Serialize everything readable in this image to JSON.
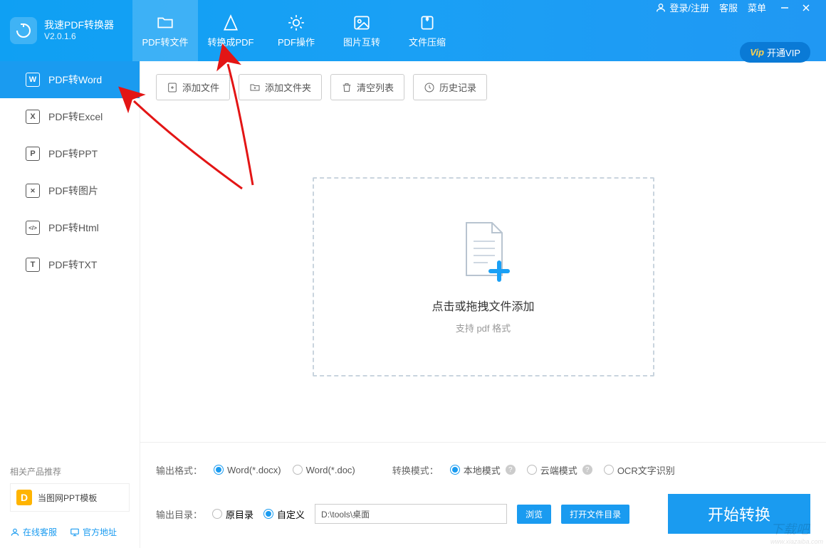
{
  "app": {
    "title": "我速PDF转换器",
    "version": "V2.0.1.6"
  },
  "header": {
    "tabs": [
      {
        "label": "PDF转文件"
      },
      {
        "label": "转换成PDF"
      },
      {
        "label": "PDF操作"
      },
      {
        "label": "图片互转"
      },
      {
        "label": "文件压缩"
      }
    ],
    "login": "登录/注册",
    "service": "客服",
    "menu": "菜单",
    "vip": "开通VIP"
  },
  "sidebar": {
    "items": [
      {
        "letter": "W",
        "label": "PDF转Word"
      },
      {
        "letter": "X",
        "label": "PDF转Excel"
      },
      {
        "letter": "P",
        "label": "PDF转PPT"
      },
      {
        "letter": "✕",
        "label": "PDF转图片"
      },
      {
        "letter": "</>",
        "label": "PDF转Html"
      },
      {
        "letter": "T",
        "label": "PDF转TXT"
      }
    ],
    "related_title": "相关产品推荐",
    "related_item": "当图网PPT模板",
    "link_service": "在线客服",
    "link_site": "官方地址"
  },
  "toolbar": {
    "add_file": "添加文件",
    "add_folder": "添加文件夹",
    "clear": "清空列表",
    "history": "历史记录"
  },
  "dropzone": {
    "title": "点击或拖拽文件添加",
    "sub": "支持 pdf 格式"
  },
  "settings": {
    "output_format_label": "输出格式：",
    "fmt_docx": "Word(*.docx)",
    "fmt_doc": "Word(*.doc)",
    "convert_mode_label": "转换模式：",
    "mode_local": "本地模式",
    "mode_cloud": "云端模式",
    "mode_ocr": "OCR文字识别",
    "output_dir_label": "输出目录：",
    "dir_original": "原目录",
    "dir_custom": "自定义",
    "path": "D:\\tools\\桌面",
    "browse": "浏览",
    "open_dir": "打开文件目录",
    "start": "开始转换"
  }
}
